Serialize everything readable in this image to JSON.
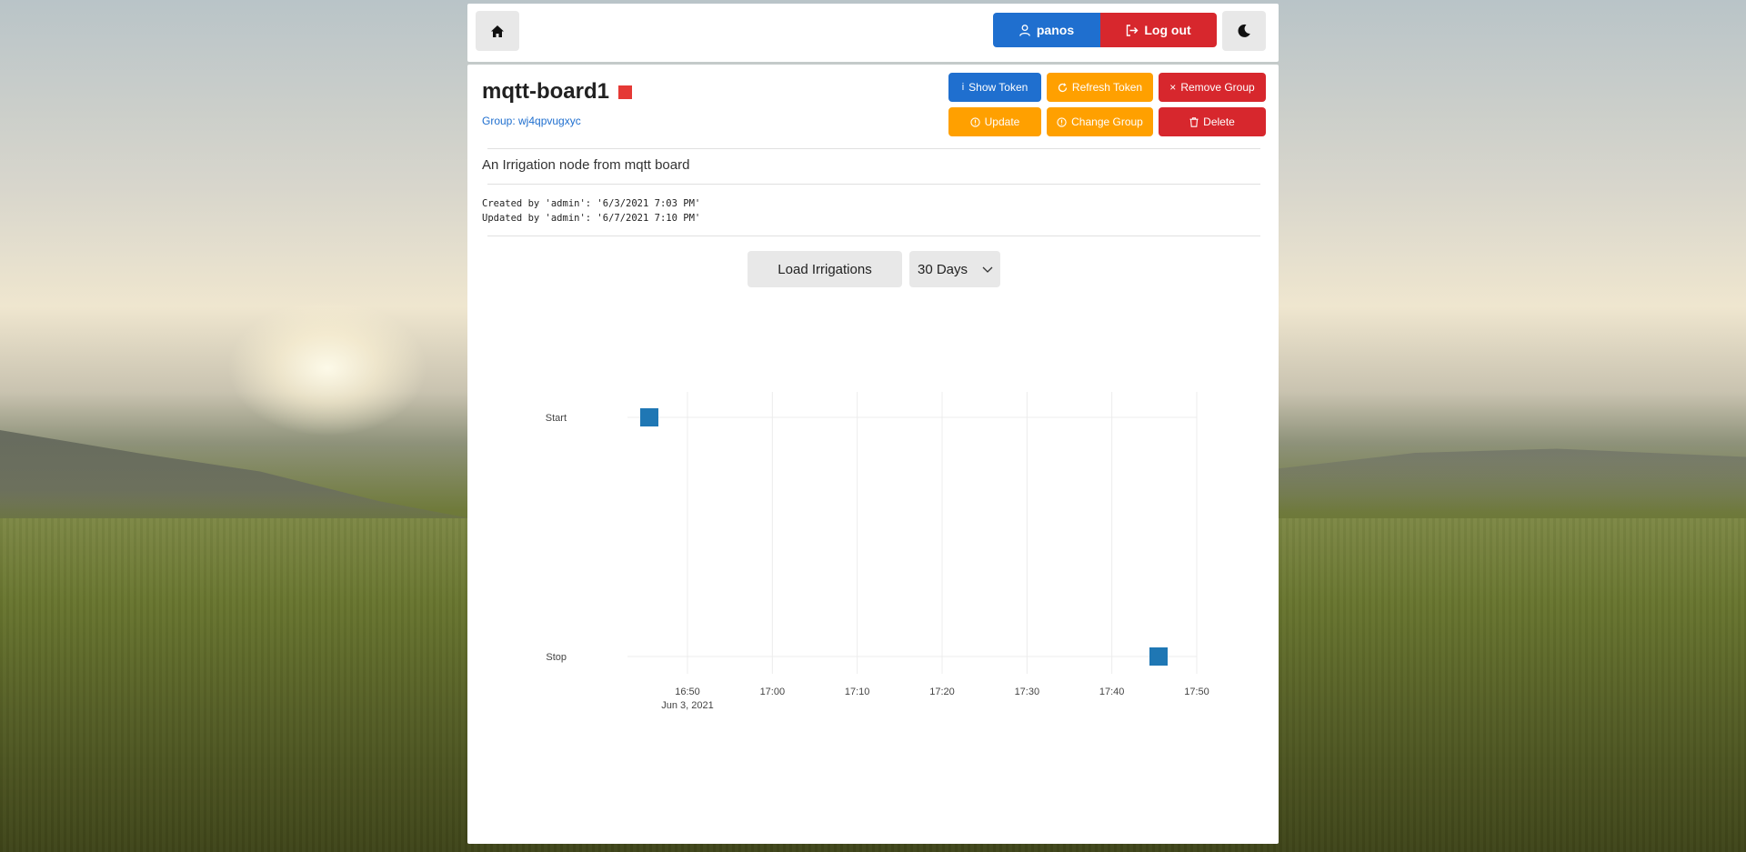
{
  "topbar": {
    "username": "panos",
    "logout_label": "Log out"
  },
  "node": {
    "title": "mqtt-board1",
    "status_color": "#e53935",
    "group_link": "Group: wj4qpvugxyc",
    "description": "An Irrigation node from mqtt board",
    "created_line": "Created by 'admin': '6/3/2021 7:03 PM'",
    "updated_line": "Updated by 'admin': '6/7/2021 7:10 PM'"
  },
  "actions": {
    "show_token": "Show Token",
    "refresh_token": "Refresh Token",
    "remove_group": "Remove Group",
    "update": "Update",
    "change_group": "Change Group",
    "delete": "Delete"
  },
  "controls": {
    "load_irrigations": "Load Irrigations",
    "range_selected": "30 Days"
  },
  "colors": {
    "primary": "#1f6fcf",
    "warning": "#ffa000",
    "danger": "#d7272d",
    "marker": "#1f77b4"
  },
  "chart_data": {
    "type": "scatter",
    "categories_y": [
      "Stop",
      "Start"
    ],
    "x_ticks": [
      "16:50",
      "17:00",
      "17:10",
      "17:20",
      "17:30",
      "17:40",
      "17:50"
    ],
    "x_date_label": "Jun 3, 2021",
    "points": [
      {
        "x": "16:45:30",
        "y": "Start"
      },
      {
        "x": "17:45:30",
        "y": "Stop"
      }
    ],
    "xlim": [
      "16:44",
      "17:50"
    ],
    "grid": true
  }
}
